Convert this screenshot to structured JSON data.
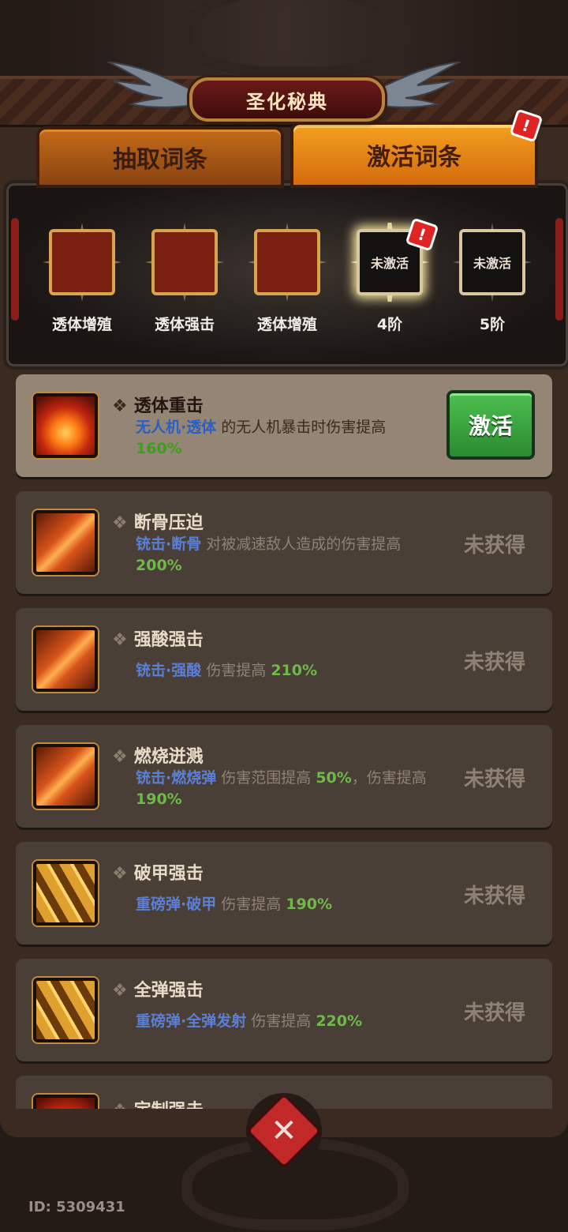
{
  "title": "圣化秘典",
  "tabs": [
    {
      "label": "抽取词条",
      "active": false
    },
    {
      "label": "激活词条",
      "active": true,
      "badge": "!"
    }
  ],
  "slots": [
    {
      "label": "透体增殖",
      "state": "filled",
      "icon": "fire-fist-icon"
    },
    {
      "label": "透体强击",
      "state": "filled",
      "icon": "fire-fist-icon"
    },
    {
      "label": "透体增殖",
      "state": "filled",
      "icon": "fire-fist-icon"
    },
    {
      "label": "4阶",
      "state": "empty",
      "empty_text": "未激活",
      "badge": "!"
    },
    {
      "label": "5阶",
      "state": "empty",
      "empty_text": "未激活"
    }
  ],
  "entries": [
    {
      "title": "透体重击",
      "tag": "无人机·透体",
      "desc_a": " 的无人机暴击时伤害提高 ",
      "num": "160%",
      "desc_b": "",
      "status": "激活",
      "selected": true,
      "icon": "fire-fist-icon"
    },
    {
      "title": "断骨压迫",
      "tag": "铳击·断骨",
      "desc_a": " 对被减速敌人造成的伤害提高 ",
      "num": "200%",
      "desc_b": "",
      "status": "未获得",
      "selected": false,
      "icon": "slash-icon"
    },
    {
      "title": "强酸强击",
      "tag": "铳击·强酸",
      "desc_a": " 伤害提高 ",
      "num": "210%",
      "desc_b": "",
      "status": "未获得",
      "selected": false,
      "icon": "slash-icon"
    },
    {
      "title": "燃烧迸溅",
      "tag": "铳击·燃烧弹",
      "desc_a": " 伤害范围提高 ",
      "num": "50%",
      "desc_b": "，伤害提高 ",
      "num2": "190%",
      "status": "未获得",
      "selected": false,
      "icon": "slash-icon"
    },
    {
      "title": "破甲强击",
      "tag": "重磅弹·破甲",
      "desc_a": " 伤害提高 ",
      "num": "190%",
      "desc_b": "",
      "status": "未获得",
      "selected": false,
      "icon": "bullets-icon"
    },
    {
      "title": "全弹强击",
      "tag": "重磅弹·全弹发射",
      "desc_a": " 伤害提高 ",
      "num": "220%",
      "desc_b": "",
      "status": "未获得",
      "selected": false,
      "icon": "bullets-icon"
    },
    {
      "title": "定制强击",
      "tag": "",
      "desc_a": "",
      "num": "",
      "desc_b": "",
      "status": "",
      "selected": false,
      "icon": "fire-fist-icon"
    }
  ],
  "close_label": "✕",
  "user_id": "ID: 5309431",
  "colors": {
    "accent_orange": "#f3a020",
    "activate_green": "#3aa83e",
    "tag_blue": "#5b7fd6",
    "num_green": "#6fb84a"
  }
}
